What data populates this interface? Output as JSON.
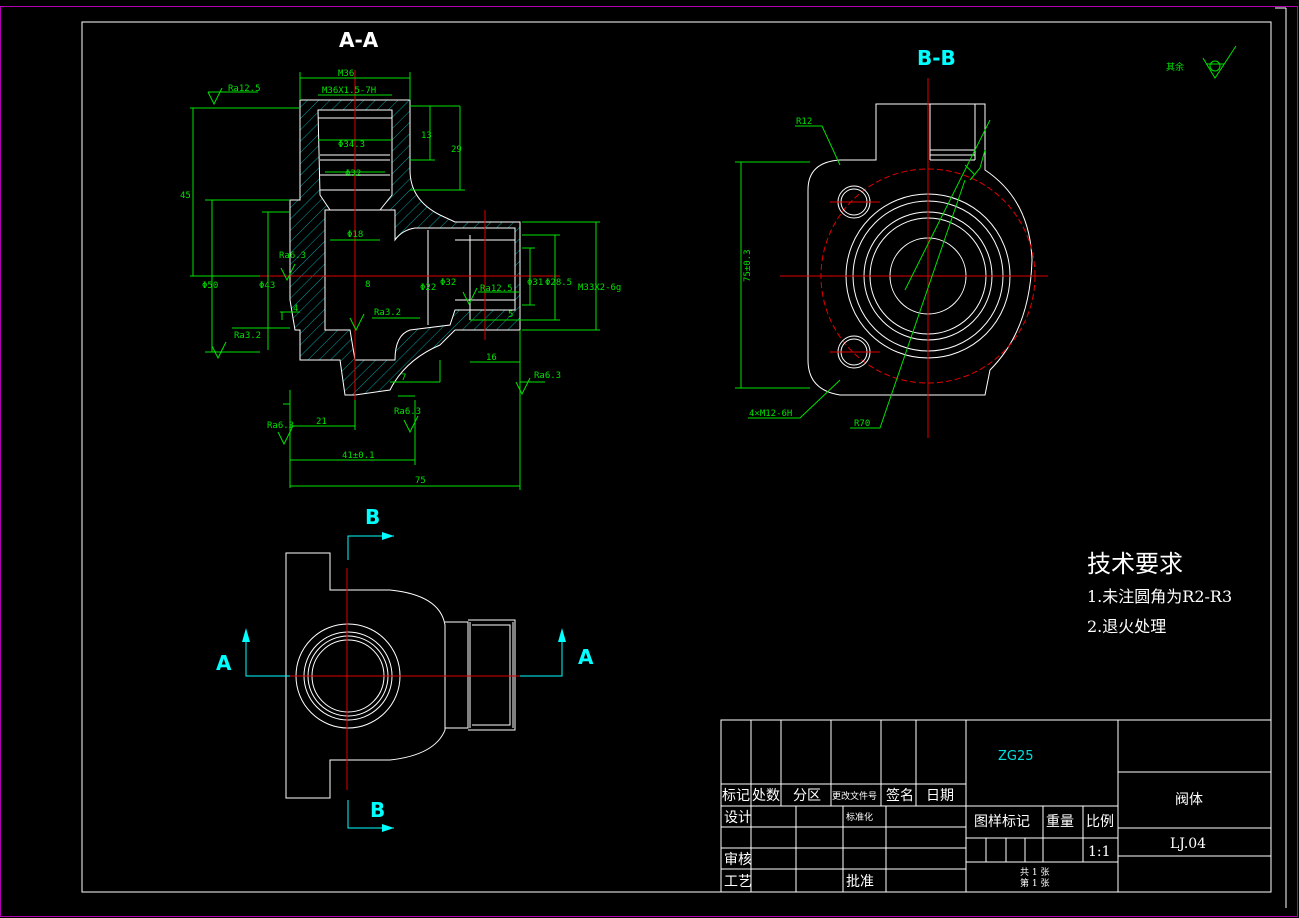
{
  "views": {
    "section_aa": "A-A",
    "section_bb": "B-B",
    "cut_label_b_top": "B",
    "cut_label_b_bottom": "B",
    "cut_label_a_left": "A",
    "cut_label_a_right": "A"
  },
  "surface_finish": {
    "others_label": "其余"
  },
  "dimensions_aa": {
    "d1": "Ra12.5",
    "d2": "M36",
    "d3": "M36X1.5-7H",
    "d4": "Φ34.3",
    "d5": "Φ32",
    "d6": "Φ18",
    "d7": "13",
    "d8": "29",
    "d9": "45",
    "d10": "Ra6.3",
    "d11": "Ra3.2",
    "d12": "Φ43",
    "d13": "Φ50",
    "d14": "4",
    "d15": "8",
    "d16": "Φ22",
    "d17": "Ra3.2",
    "d18": "Ra12.5",
    "d19": "5",
    "d20": "16",
    "d21": "Ra6.3",
    "d22": "Φ28.5",
    "d23": "Φ31",
    "d24": "M33X2-6g",
    "d25": "7",
    "d26": "Ra6.3",
    "d27": "Ra6.3",
    "d28": "21",
    "d29": "41±0.1",
    "d30": "75",
    "d31": "Φ32"
  },
  "dimensions_bb": {
    "d1": "R12",
    "d2": "75±0.3",
    "d3": "4×M12-6H",
    "d4": "R70"
  },
  "tech_requirements": {
    "title": "技术要求",
    "item1": "1.未注圆角为R2-R3",
    "item2": "2.退火处理"
  },
  "title_block": {
    "material": "ZG25",
    "part_name": "阀体",
    "drawing_no": "LJ.04",
    "mark": "标记",
    "count": "处数",
    "zone": "分区",
    "change_doc": "更改文件号",
    "signature": "签名",
    "date": "日期",
    "design": "设计",
    "standardize": "标准化",
    "review": "审核",
    "process": "工艺",
    "approve": "批准",
    "stage_mark": "图样标记",
    "weight": "重量",
    "scale_label": "比例",
    "scale": "1:1",
    "sheets_total": "共 1 张",
    "sheet_no": "第 1 张"
  }
}
